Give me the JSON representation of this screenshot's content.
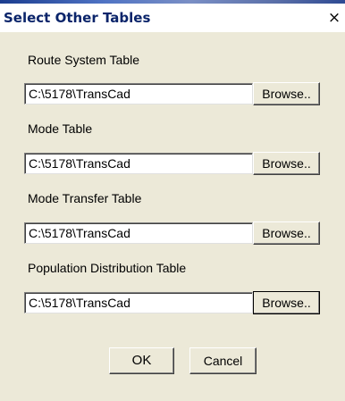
{
  "window": {
    "title": "Select Other Tables",
    "close_icon": "close-icon",
    "close_glyph": "×"
  },
  "fields": [
    {
      "label": "Route System Table",
      "value": "C:\\5178\\TransCad",
      "button": "Browse.."
    },
    {
      "label": "Mode Table",
      "value": "C:\\5178\\TransCad",
      "button": "Browse.."
    },
    {
      "label": "Mode Transfer Table",
      "value": "C:\\5178\\TransCad",
      "button": "Browse.."
    },
    {
      "label": "Population Distribution Table",
      "value": "C:\\5178\\TransCad",
      "button": "Browse.."
    }
  ],
  "buttons": {
    "ok": "OK",
    "cancel": "Cancel"
  }
}
